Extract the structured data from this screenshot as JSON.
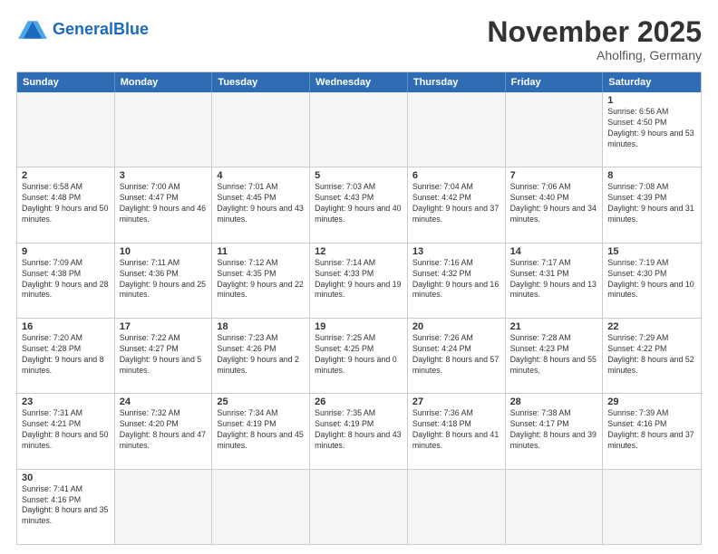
{
  "header": {
    "logo_general": "General",
    "logo_blue": "Blue",
    "month_title": "November 2025",
    "subtitle": "Aholfing, Germany"
  },
  "days_of_week": [
    "Sunday",
    "Monday",
    "Tuesday",
    "Wednesday",
    "Thursday",
    "Friday",
    "Saturday"
  ],
  "weeks": [
    [
      {
        "day": "",
        "info": ""
      },
      {
        "day": "",
        "info": ""
      },
      {
        "day": "",
        "info": ""
      },
      {
        "day": "",
        "info": ""
      },
      {
        "day": "",
        "info": ""
      },
      {
        "day": "",
        "info": ""
      },
      {
        "day": "1",
        "info": "Sunrise: 6:56 AM\nSunset: 4:50 PM\nDaylight: 9 hours\nand 53 minutes."
      }
    ],
    [
      {
        "day": "2",
        "info": "Sunrise: 6:58 AM\nSunset: 4:48 PM\nDaylight: 9 hours\nand 50 minutes."
      },
      {
        "day": "3",
        "info": "Sunrise: 7:00 AM\nSunset: 4:47 PM\nDaylight: 9 hours\nand 46 minutes."
      },
      {
        "day": "4",
        "info": "Sunrise: 7:01 AM\nSunset: 4:45 PM\nDaylight: 9 hours\nand 43 minutes."
      },
      {
        "day": "5",
        "info": "Sunrise: 7:03 AM\nSunset: 4:43 PM\nDaylight: 9 hours\nand 40 minutes."
      },
      {
        "day": "6",
        "info": "Sunrise: 7:04 AM\nSunset: 4:42 PM\nDaylight: 9 hours\nand 37 minutes."
      },
      {
        "day": "7",
        "info": "Sunrise: 7:06 AM\nSunset: 4:40 PM\nDaylight: 9 hours\nand 34 minutes."
      },
      {
        "day": "8",
        "info": "Sunrise: 7:08 AM\nSunset: 4:39 PM\nDaylight: 9 hours\nand 31 minutes."
      }
    ],
    [
      {
        "day": "9",
        "info": "Sunrise: 7:09 AM\nSunset: 4:38 PM\nDaylight: 9 hours\nand 28 minutes."
      },
      {
        "day": "10",
        "info": "Sunrise: 7:11 AM\nSunset: 4:36 PM\nDaylight: 9 hours\nand 25 minutes."
      },
      {
        "day": "11",
        "info": "Sunrise: 7:12 AM\nSunset: 4:35 PM\nDaylight: 9 hours\nand 22 minutes."
      },
      {
        "day": "12",
        "info": "Sunrise: 7:14 AM\nSunset: 4:33 PM\nDaylight: 9 hours\nand 19 minutes."
      },
      {
        "day": "13",
        "info": "Sunrise: 7:16 AM\nSunset: 4:32 PM\nDaylight: 9 hours\nand 16 minutes."
      },
      {
        "day": "14",
        "info": "Sunrise: 7:17 AM\nSunset: 4:31 PM\nDaylight: 9 hours\nand 13 minutes."
      },
      {
        "day": "15",
        "info": "Sunrise: 7:19 AM\nSunset: 4:30 PM\nDaylight: 9 hours\nand 10 minutes."
      }
    ],
    [
      {
        "day": "16",
        "info": "Sunrise: 7:20 AM\nSunset: 4:28 PM\nDaylight: 9 hours\nand 8 minutes."
      },
      {
        "day": "17",
        "info": "Sunrise: 7:22 AM\nSunset: 4:27 PM\nDaylight: 9 hours\nand 5 minutes."
      },
      {
        "day": "18",
        "info": "Sunrise: 7:23 AM\nSunset: 4:26 PM\nDaylight: 9 hours\nand 2 minutes."
      },
      {
        "day": "19",
        "info": "Sunrise: 7:25 AM\nSunset: 4:25 PM\nDaylight: 9 hours\nand 0 minutes."
      },
      {
        "day": "20",
        "info": "Sunrise: 7:26 AM\nSunset: 4:24 PM\nDaylight: 8 hours\nand 57 minutes."
      },
      {
        "day": "21",
        "info": "Sunrise: 7:28 AM\nSunset: 4:23 PM\nDaylight: 8 hours\nand 55 minutes."
      },
      {
        "day": "22",
        "info": "Sunrise: 7:29 AM\nSunset: 4:22 PM\nDaylight: 8 hours\nand 52 minutes."
      }
    ],
    [
      {
        "day": "23",
        "info": "Sunrise: 7:31 AM\nSunset: 4:21 PM\nDaylight: 8 hours\nand 50 minutes."
      },
      {
        "day": "24",
        "info": "Sunrise: 7:32 AM\nSunset: 4:20 PM\nDaylight: 8 hours\nand 47 minutes."
      },
      {
        "day": "25",
        "info": "Sunrise: 7:34 AM\nSunset: 4:19 PM\nDaylight: 8 hours\nand 45 minutes."
      },
      {
        "day": "26",
        "info": "Sunrise: 7:35 AM\nSunset: 4:19 PM\nDaylight: 8 hours\nand 43 minutes."
      },
      {
        "day": "27",
        "info": "Sunrise: 7:36 AM\nSunset: 4:18 PM\nDaylight: 8 hours\nand 41 minutes."
      },
      {
        "day": "28",
        "info": "Sunrise: 7:38 AM\nSunset: 4:17 PM\nDaylight: 8 hours\nand 39 minutes."
      },
      {
        "day": "29",
        "info": "Sunrise: 7:39 AM\nSunset: 4:16 PM\nDaylight: 8 hours\nand 37 minutes."
      }
    ],
    [
      {
        "day": "30",
        "info": "Sunrise: 7:41 AM\nSunset: 4:16 PM\nDaylight: 8 hours\nand 35 minutes."
      },
      {
        "day": "",
        "info": ""
      },
      {
        "day": "",
        "info": ""
      },
      {
        "day": "",
        "info": ""
      },
      {
        "day": "",
        "info": ""
      },
      {
        "day": "",
        "info": ""
      },
      {
        "day": "",
        "info": ""
      }
    ]
  ]
}
